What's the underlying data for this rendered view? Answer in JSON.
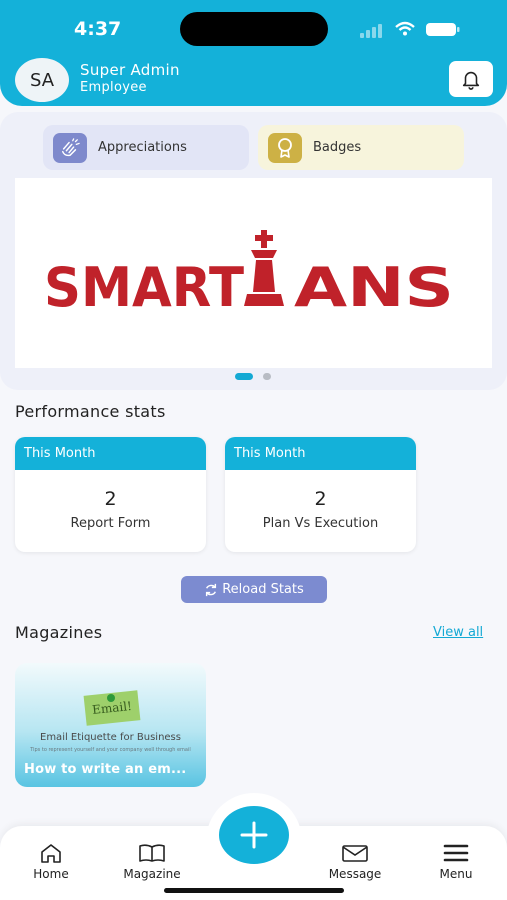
{
  "status_bar": {
    "time": "4:37"
  },
  "header": {
    "avatar_initials": "SA",
    "user_name": "Super Admin",
    "user_role": "Employee"
  },
  "quick_links": [
    {
      "label": "Appreciations",
      "icon": "clap-hands-icon"
    },
    {
      "label": "Badges",
      "icon": "badge-icon"
    }
  ],
  "banner": {
    "logo_text_left": "SMART",
    "logo_text_right": "ANS",
    "alt": "SMARTIANS"
  },
  "performance": {
    "title": "Performance stats",
    "stats": [
      {
        "period": "This Month",
        "value": "2",
        "label": "Report Form"
      },
      {
        "period": "This Month",
        "value": "2",
        "label": "Plan Vs Execution"
      }
    ],
    "reload_label": "Reload Stats"
  },
  "magazines": {
    "title": "Magazines",
    "view_all_label": "View all",
    "items": [
      {
        "title": "How to write an em...",
        "cover_heading": "Email Etiquette for Business",
        "cover_note_text": "Email!",
        "cover_tagline": "Tips to represent yourself and your company well through email"
      }
    ]
  },
  "bottom_nav": [
    {
      "label": "Home",
      "icon": "home-icon"
    },
    {
      "label": "Magazine",
      "icon": "book-icon"
    },
    {
      "label": "Message",
      "icon": "mail-icon"
    },
    {
      "label": "Menu",
      "icon": "hamburger-menu-icon"
    }
  ],
  "colors": {
    "primary": "#14b1d9",
    "accent": "#7c8bd0",
    "logo_red": "#c0222a"
  }
}
